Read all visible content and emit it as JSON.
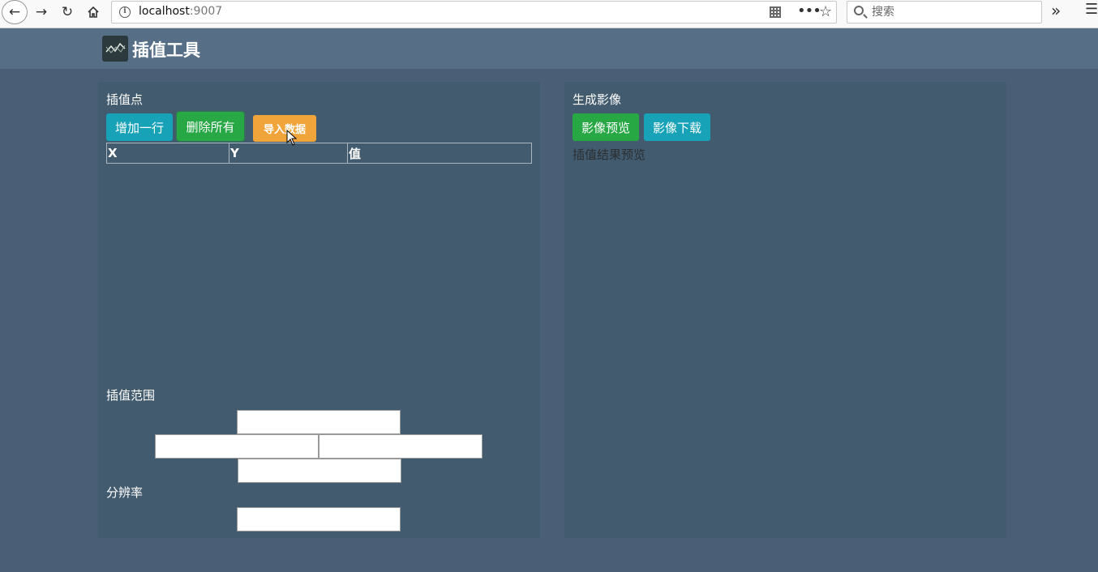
{
  "browser": {
    "url_host": "localhost",
    "url_port": ":9007",
    "search_placeholder": "搜索"
  },
  "app": {
    "title": "插值工具"
  },
  "left_panel": {
    "points_title": "插值点",
    "buttons": {
      "add_row": "增加一行",
      "delete_all": "删除所有",
      "import_data": "导入数据"
    },
    "table_headers": [
      "X",
      "Y",
      "值"
    ],
    "range_title": "插值范围",
    "resolution_title": "分辨率"
  },
  "right_panel": {
    "title": "生成影像",
    "buttons": {
      "preview": "影像预览",
      "download": "影像下载"
    },
    "preview_label": "插值结果预览"
  },
  "colors": {
    "page_bg": "#4a5f75",
    "header_bg": "#566f86",
    "panel_bg": "#425b6e",
    "cyan": "#17a2b8",
    "green": "#28a745",
    "orange": "#f0a43a"
  }
}
